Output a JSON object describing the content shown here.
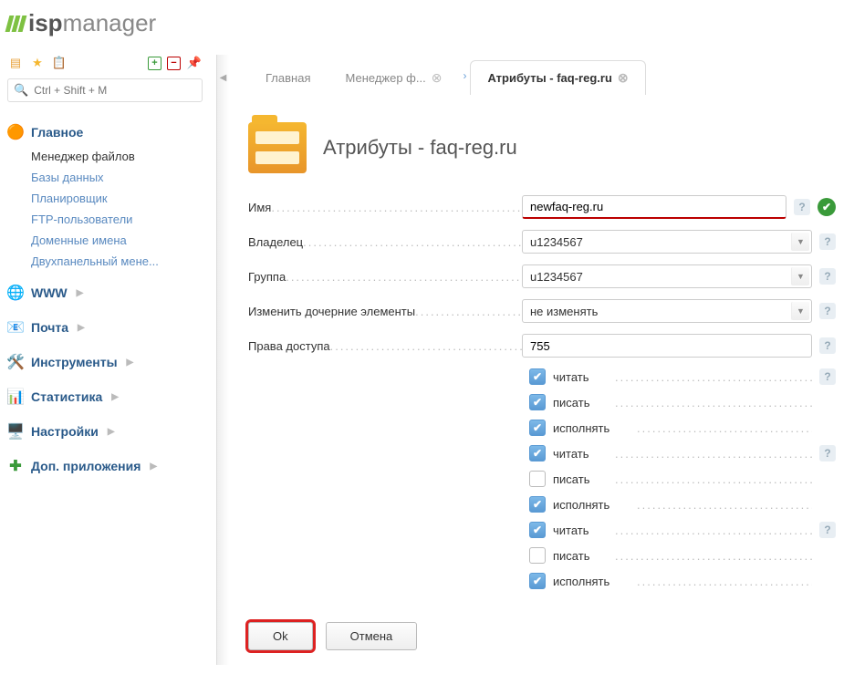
{
  "logo": {
    "bold": "isp",
    "light": "manager"
  },
  "search": {
    "placeholder": "Ctrl + Shift + M"
  },
  "sidebar": {
    "main": {
      "label": "Главное",
      "items": [
        "Менеджер файлов",
        "Базы данных",
        "Планировщик",
        "FTP-пользователи",
        "Доменные имена",
        "Двухпанельный мене..."
      ]
    },
    "sections": [
      {
        "label": "WWW"
      },
      {
        "label": "Почта"
      },
      {
        "label": "Инструменты"
      },
      {
        "label": "Статистика"
      },
      {
        "label": "Настройки"
      },
      {
        "label": "Доп. приложения"
      }
    ]
  },
  "tabs": [
    {
      "label": "Главная"
    },
    {
      "label": "Менеджер ф..."
    },
    {
      "label": "Атрибуты - faq-reg.ru"
    }
  ],
  "page": {
    "title": "Атрибуты - faq-reg.ru"
  },
  "form": {
    "name": {
      "label": "Имя",
      "value": "newfaq-reg.ru"
    },
    "owner": {
      "label": "Владелец",
      "value": "u1234567"
    },
    "group": {
      "label": "Группа",
      "value": "u1234567"
    },
    "children": {
      "label": "Изменить дочерние элементы",
      "value": "не изменять"
    },
    "perms": {
      "label": "Права доступа",
      "value": "755"
    },
    "perm_list": [
      {
        "label": "читать",
        "checked": true,
        "help": true
      },
      {
        "label": "писать",
        "checked": true,
        "help": false
      },
      {
        "label": "исполнять",
        "checked": true,
        "help": false
      },
      {
        "label": "читать",
        "checked": true,
        "help": true
      },
      {
        "label": "писать",
        "checked": false,
        "help": false
      },
      {
        "label": "исполнять",
        "checked": true,
        "help": false
      },
      {
        "label": "читать",
        "checked": true,
        "help": true
      },
      {
        "label": "писать",
        "checked": false,
        "help": false
      },
      {
        "label": "исполнять",
        "checked": true,
        "help": false
      }
    ]
  },
  "buttons": {
    "ok": "Ok",
    "cancel": "Отмена"
  }
}
